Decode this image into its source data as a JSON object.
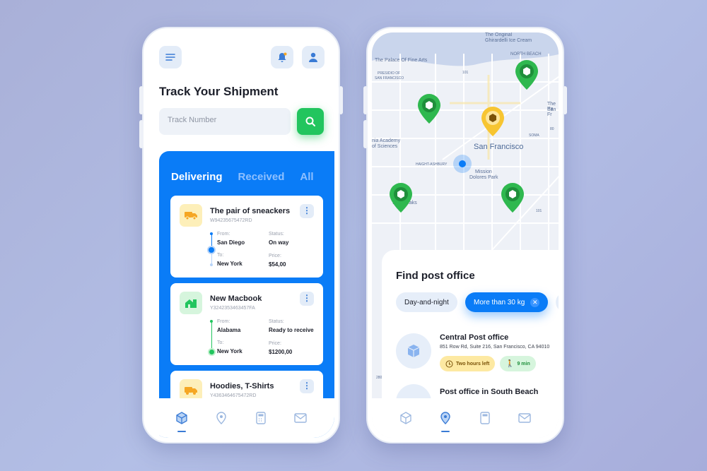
{
  "left_phone": {
    "header": {
      "menu_icon": "menu-icon",
      "bell_icon": "bell-icon",
      "profile_icon": "user-icon",
      "badge_color": "#f5a623"
    },
    "title": "Track Your Shipment",
    "search": {
      "placeholder": "Track Number",
      "button_icon": "search-icon"
    },
    "tabs": [
      {
        "label": "Delivering",
        "active": true
      },
      {
        "label": "Received",
        "active": false
      },
      {
        "label": "All",
        "active": false
      }
    ],
    "shipments": [
      {
        "name": "The pair of sneackers",
        "tracking": "W94235675472RD",
        "from_label": "From:",
        "from": "San Diego",
        "to_label": "To:",
        "to": "New York",
        "status_label": "Status:",
        "status": "On way",
        "price_label": "Price:",
        "price": "$54,00",
        "icon": "truck-icon"
      },
      {
        "name": "New Macbook",
        "tracking": "Y3242353463457FA",
        "from_label": "From:",
        "from": "Alabama",
        "to_label": "To:",
        "to": "New York",
        "status_label": "Status:",
        "status": "Ready to receive",
        "price_label": "Price:",
        "price": "$1200,00",
        "icon": "house-icon"
      },
      {
        "name": "Hoodies, T-Shirts",
        "tracking": "Y4363464675472RD",
        "icon": "truck-icon"
      }
    ],
    "nav": [
      {
        "icon": "box-icon",
        "active": true
      },
      {
        "icon": "location-icon"
      },
      {
        "icon": "calculator-icon"
      },
      {
        "icon": "mail-icon"
      }
    ],
    "accent": "#0a7cf7",
    "success": "#22c55e"
  },
  "right_phone": {
    "map": {
      "labels": [
        "The Original",
        "Ghirardelli Ice Cream",
        "NORTH BEACH",
        "The Palace Of Fine Arts",
        "PRESIDIO OF",
        "SAN FRANCISCO",
        "101",
        "The Pa",
        "San Fr",
        "SOMA",
        "80",
        "San Francisco",
        "HAIGHT-ASHBURY",
        "Mission",
        "Dolores Park",
        "nia Academy",
        "of Sciences",
        "Twin Peaks",
        "101",
        "280"
      ]
    },
    "panel": {
      "title": "Find post office",
      "filters": [
        {
          "label": "Day-and-night",
          "active": false
        },
        {
          "label": "More than 30 kg",
          "active": true
        }
      ],
      "offices": [
        {
          "name": "Central Post office",
          "address": "851 Row Rd, Suite 216, San Francisco, CA 94010",
          "time": "Two hours left",
          "walk": "9 min"
        },
        {
          "name": "Post office in South Beach"
        }
      ]
    },
    "nav": [
      {
        "icon": "box-icon"
      },
      {
        "icon": "location-icon",
        "active": true
      },
      {
        "icon": "calculator-icon"
      },
      {
        "icon": "mail-icon"
      }
    ]
  }
}
